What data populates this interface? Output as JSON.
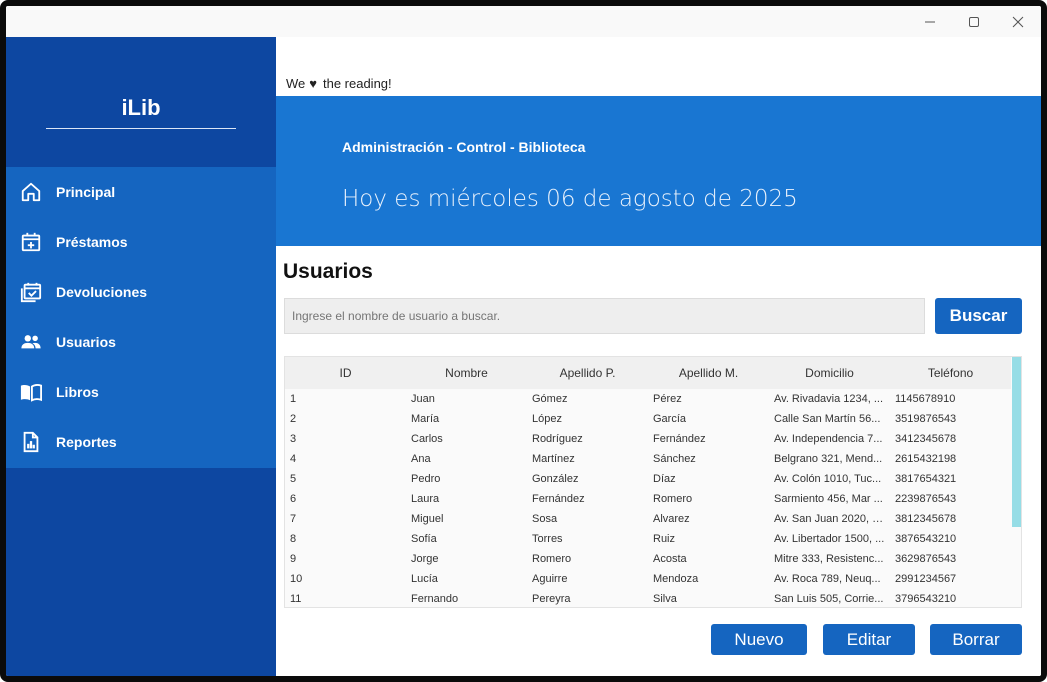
{
  "window": {
    "controls": {
      "minimize": "—",
      "maximize": "☐",
      "close": "✕"
    }
  },
  "sidebar": {
    "brand": "iLib",
    "items": [
      {
        "label": "Principal",
        "icon": "home-icon"
      },
      {
        "label": "Préstamos",
        "icon": "calendar-plus-icon"
      },
      {
        "label": "Devoluciones",
        "icon": "calendar-check-icon"
      },
      {
        "label": "Usuarios",
        "icon": "users-icon"
      },
      {
        "label": "Libros",
        "icon": "open-book-icon"
      },
      {
        "label": "Reportes",
        "icon": "report-chart-icon"
      }
    ]
  },
  "header": {
    "tagline_we": "We",
    "tagline_heart": "♥",
    "tagline_rest": "the reading!",
    "subtitle": "Administración - Control - Biblioteca",
    "date": "Hoy es miércoles 06 de agosto de 2025"
  },
  "main": {
    "title": "Usuarios",
    "search": {
      "placeholder": "Ingrese el nombre de usuario a buscar.",
      "button": "Buscar"
    },
    "table": {
      "columns": [
        "ID",
        "Nombre",
        "Apellido P.",
        "Apellido M.",
        "Domicilio",
        "Teléfono"
      ],
      "rows": [
        [
          "1",
          "Juan",
          "Gómez",
          "Pérez",
          "Av. Rivadavia 1234, ...",
          "1145678910"
        ],
        [
          "2",
          "María",
          "López",
          "García",
          "Calle San Martín 56...",
          "3519876543"
        ],
        [
          "3",
          "Carlos",
          "Rodríguez",
          "Fernández",
          "Av. Independencia 7...",
          "3412345678"
        ],
        [
          "4",
          "Ana",
          "Martínez",
          "Sánchez",
          "Belgrano 321, Mend...",
          "2615432198"
        ],
        [
          "5",
          "Pedro",
          "González",
          "Díaz",
          "Av. Colón 1010, Tuc...",
          "3817654321"
        ],
        [
          "6",
          "Laura",
          "Fernández",
          "Romero",
          "Sarmiento 456, Mar ...",
          "2239876543"
        ],
        [
          "7",
          "Miguel",
          "Sosa",
          "Alvarez",
          "Av. San Juan 2020, S...",
          "3812345678"
        ],
        [
          "8",
          "Sofía",
          "Torres",
          "Ruiz",
          "Av. Libertador 1500, ...",
          "3876543210"
        ],
        [
          "9",
          "Jorge",
          "Romero",
          "Acosta",
          "Mitre 333, Resistenc...",
          "3629876543"
        ],
        [
          "10",
          "Lucía",
          "Aguirre",
          "Mendoza",
          "Av. Roca 789, Neuq...",
          "2991234567"
        ],
        [
          "11",
          "Fernando",
          "Pereyra",
          "Silva",
          "San Luis 505, Corrie...",
          "3796543210"
        ]
      ]
    },
    "actions": {
      "new": "Nuevo",
      "edit": "Editar",
      "delete": "Borrar"
    }
  },
  "colors": {
    "sidebar_dark": "#0d47a1",
    "sidebar_nav": "#1565c0",
    "banner": "#1976d2",
    "button": "#1565c0",
    "scroll_thumb": "#96dde6"
  }
}
